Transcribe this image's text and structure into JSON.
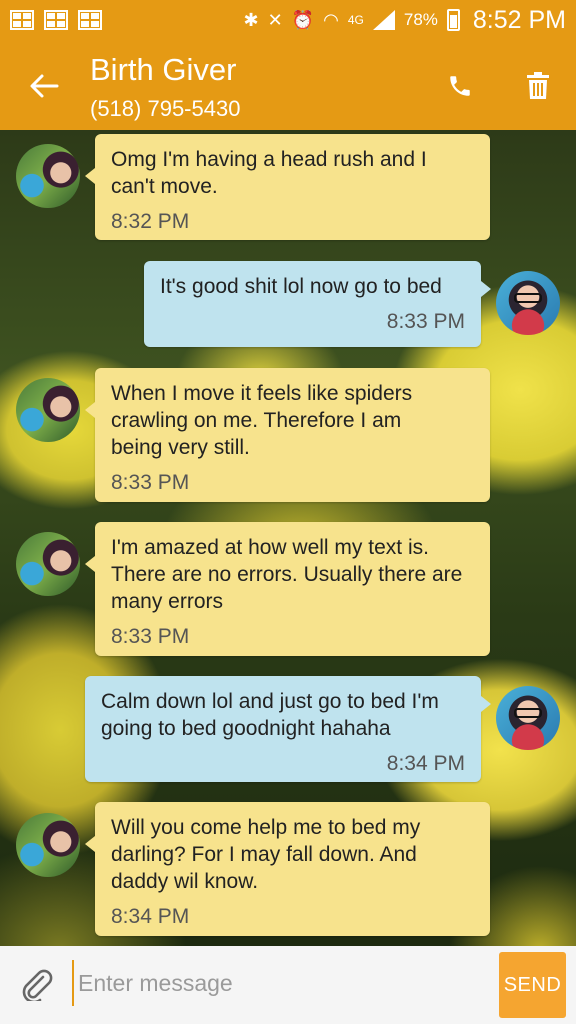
{
  "status_bar": {
    "battery_percent": "78%",
    "time": "8:52 PM",
    "network": "4G"
  },
  "header": {
    "contact_name": "Birth Giver",
    "contact_phone": "(518) 795-5430"
  },
  "messages": [
    {
      "direction": "in",
      "text": "Omg I'm having a head rush and I\ncan't move.",
      "time": "8:32 PM"
    },
    {
      "direction": "out",
      "text": "It's good shit lol now go to bed",
      "time": "8:33 PM"
    },
    {
      "direction": "in",
      "text": "When I move it feels like spiders\ncrawling on me. Therefore I am\nbeing very still.",
      "time": "8:33 PM"
    },
    {
      "direction": "in",
      "text": "I'm amazed at how well my text is.\nThere are no errors. Usually there are\nmany errors",
      "time": "8:33 PM"
    },
    {
      "direction": "out",
      "text": "Calm down lol and just go to bed I'm\ngoing to bed goodnight hahaha",
      "time": "8:34 PM"
    },
    {
      "direction": "in",
      "text": "Will you come help me to bed my\ndarling? For I may fall down. And\ndaddy wil know.",
      "time": "8:34 PM"
    }
  ],
  "composer": {
    "placeholder": "Enter message",
    "send_label": "SEND"
  },
  "colors": {
    "accent": "#e59a14",
    "incoming_bubble": "#f7e38d",
    "outgoing_bubble": "#bfe3ee",
    "send_button": "#f5a530"
  }
}
